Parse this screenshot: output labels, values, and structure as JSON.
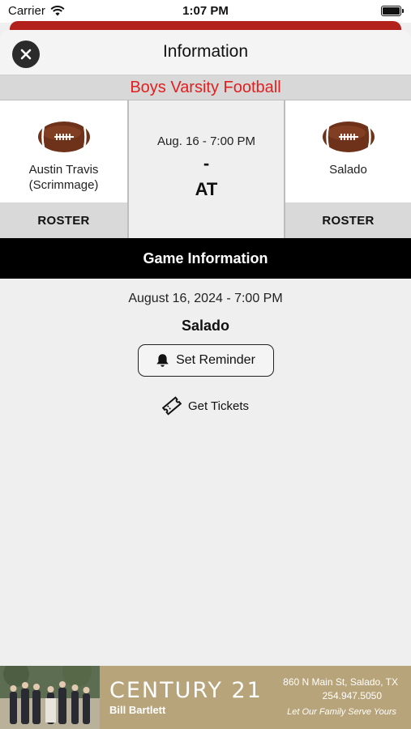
{
  "status_bar": {
    "carrier": "Carrier",
    "time": "1:07 PM"
  },
  "header": {
    "title": "Information"
  },
  "sport": {
    "title": "Boys Varsity Football"
  },
  "matchup": {
    "home": {
      "name_line1": "Austin Travis",
      "name_line2": "(Scrimmage)",
      "roster_label": "ROSTER"
    },
    "center": {
      "date": "Aug. 16 - 7:00 PM",
      "score": "-",
      "at": "AT"
    },
    "away": {
      "name": "Salado",
      "roster_label": "ROSTER"
    }
  },
  "game_info": {
    "section_title": "Game Information",
    "date": "August 16, 2024 - 7:00 PM",
    "location": "Salado",
    "reminder_label": "Set Reminder",
    "tickets_label": "Get Tickets"
  },
  "ad": {
    "brand": "CENTURY 21",
    "agent": "Bill Bartlett",
    "address": "860 N Main St, Salado, TX",
    "phone": "254.947.5050",
    "tagline": "Let Our Family Serve Yours"
  },
  "colors": {
    "accent_red": "#e02020",
    "strip_red": "#b3211d",
    "section_black": "#000000",
    "ad_gold": "#b8a47a"
  },
  "icons": [
    "wifi-icon",
    "battery-icon",
    "close-icon",
    "football-icon",
    "bell-icon",
    "ticket-icon"
  ]
}
